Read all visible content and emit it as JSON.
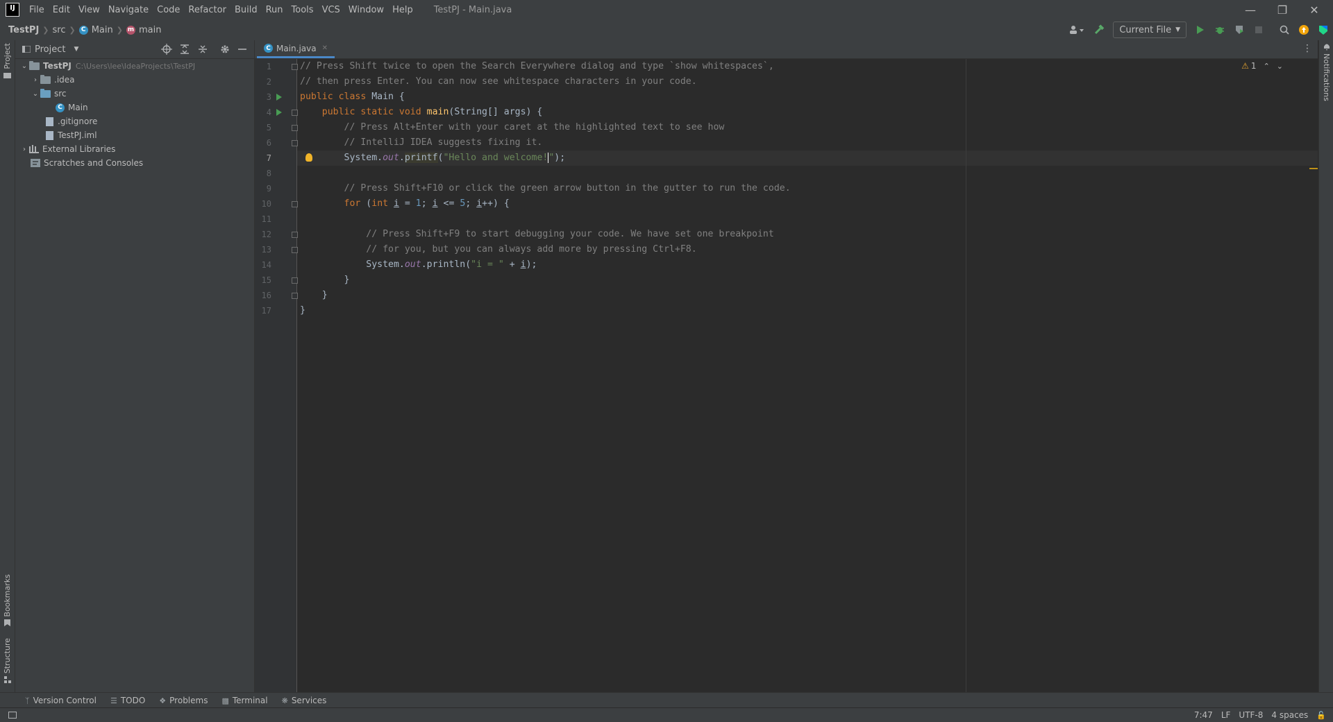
{
  "app": {
    "logo_text": "IJ",
    "menu": [
      "File",
      "Edit",
      "View",
      "Navigate",
      "Code",
      "Refactor",
      "Build",
      "Run",
      "Tools",
      "VCS",
      "Window",
      "Help"
    ],
    "window_title": "TestPJ - Main.java"
  },
  "breadcrumb": [
    "TestPJ",
    "src",
    "Main",
    "main"
  ],
  "toolbar": {
    "run_config": "Current File"
  },
  "project": {
    "header": "Project",
    "root_name": "TestPJ",
    "root_path": "C:\\Users\\lee\\IdeaProjects\\TestPJ",
    "items": [
      ".idea",
      "src",
      "Main",
      ".gitignore",
      "TestPJ.iml",
      "External Libraries",
      "Scratches and Consoles"
    ]
  },
  "editor": {
    "tab": "Main.java",
    "warnings": "1",
    "line_numbers": [
      "1",
      "2",
      "3",
      "4",
      "5",
      "6",
      "7",
      "8",
      "9",
      "10",
      "11",
      "12",
      "13",
      "14",
      "15",
      "16",
      "17"
    ],
    "current_line": 7
  },
  "left_strip": {
    "project": "Project",
    "bookmarks": "Bookmarks",
    "structure": "Structure"
  },
  "right_strip": {
    "notifications": "Notifications"
  },
  "bottom_tools": [
    "Version Control",
    "TODO",
    "Problems",
    "Terminal",
    "Services"
  ],
  "status": {
    "position": "7:47",
    "line_sep": "LF",
    "encoding": "UTF-8",
    "indent": "4 spaces"
  }
}
